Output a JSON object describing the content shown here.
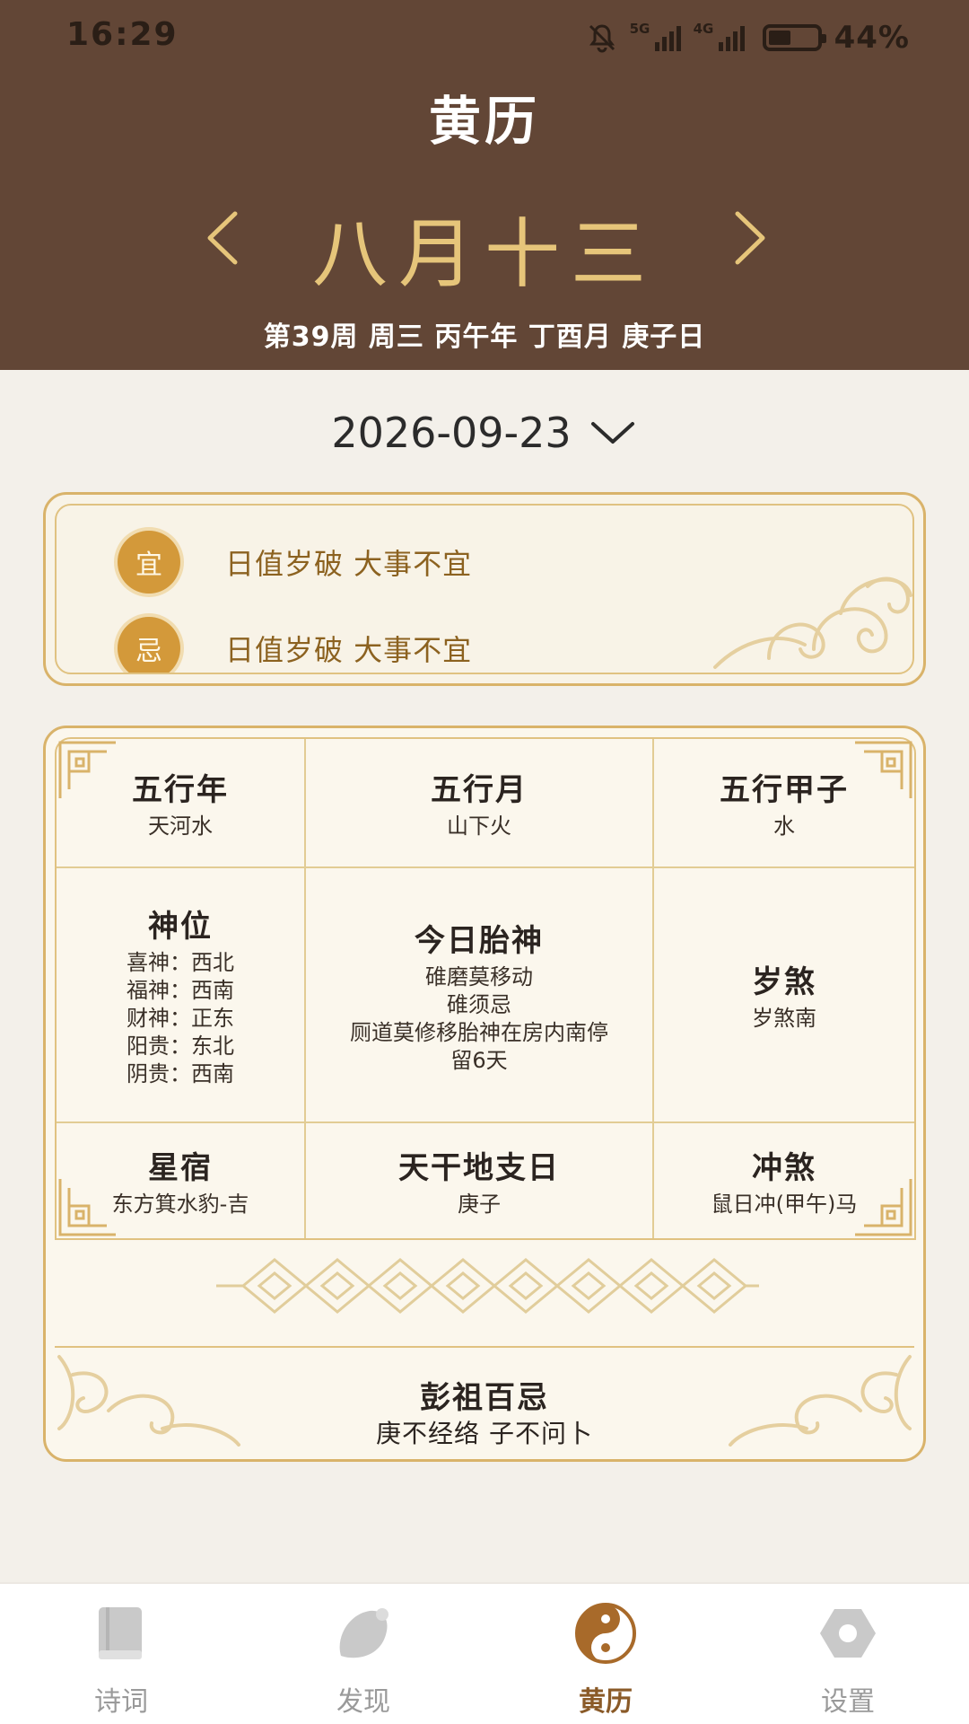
{
  "status_bar": {
    "time": "16:29",
    "network_1": "5G",
    "network_2": "4G",
    "battery": "44%",
    "battery_level": 0.44,
    "icons": [
      "mute-bell-icon",
      "signal-5g-icon",
      "signal-4g-icon",
      "battery-icon"
    ]
  },
  "header": {
    "title": "黄历",
    "lunar_date": "八月十三",
    "ganzhi_line": "第39周 周三 丙午年 丁酉月 庚子日",
    "prev_icon": "chevron-left-icon",
    "next_icon": "chevron-right-icon"
  },
  "date_selector": {
    "date": "2026-09-23",
    "icon": "chevron-down-icon"
  },
  "yiji": {
    "yi_label": "宜",
    "yi_text": "日值岁破 大事不宜",
    "ji_label": "忌",
    "ji_text": "日值岁破 大事不宜"
  },
  "almanac": {
    "wuxing_year": {
      "title": "五行年",
      "value": "天河水"
    },
    "wuxing_month": {
      "title": "五行月",
      "value": "山下火"
    },
    "wuxing_jiazi": {
      "title": "五行甲子",
      "value": "水"
    },
    "shenwei": {
      "title": "神位",
      "lines": [
        "喜神：西北",
        "福神：西南",
        "财神：正东",
        "阳贵：东北",
        "阴贵：西南"
      ]
    },
    "taishen": {
      "title": "今日胎神",
      "lines": [
        "碓磨莫移动",
        "碓须忌",
        "厕道莫修移胎神在房内南停",
        "留6天"
      ]
    },
    "suisha": {
      "title": "岁煞",
      "value": "岁煞南"
    },
    "xingxiu": {
      "title": "星宿",
      "value": "东方箕水豹-吉"
    },
    "tiangan_dizhi": {
      "title": "天干地支日",
      "value": "庚子"
    },
    "chongsha": {
      "title": "冲煞",
      "value": "鼠日冲(甲午)马"
    }
  },
  "pengzu": {
    "title": "彭祖百忌",
    "text": "庚不经络 子不问卜"
  },
  "bottom_nav": {
    "items": [
      {
        "label": "诗词",
        "icon": "book-icon",
        "active": false
      },
      {
        "label": "发现",
        "icon": "discover-blob-icon",
        "active": false
      },
      {
        "label": "黄历",
        "icon": "yin-yang-icon",
        "active": true
      },
      {
        "label": "设置",
        "icon": "settings-hexagon-icon",
        "active": false
      }
    ]
  },
  "colors": {
    "header_bg": "#624636",
    "gold_text": "#e6c57a",
    "page_bg": "#f3f0ea",
    "badge": "#d3993a",
    "border_gold": "#d9b36a",
    "active_nav": "#8a5a28"
  }
}
